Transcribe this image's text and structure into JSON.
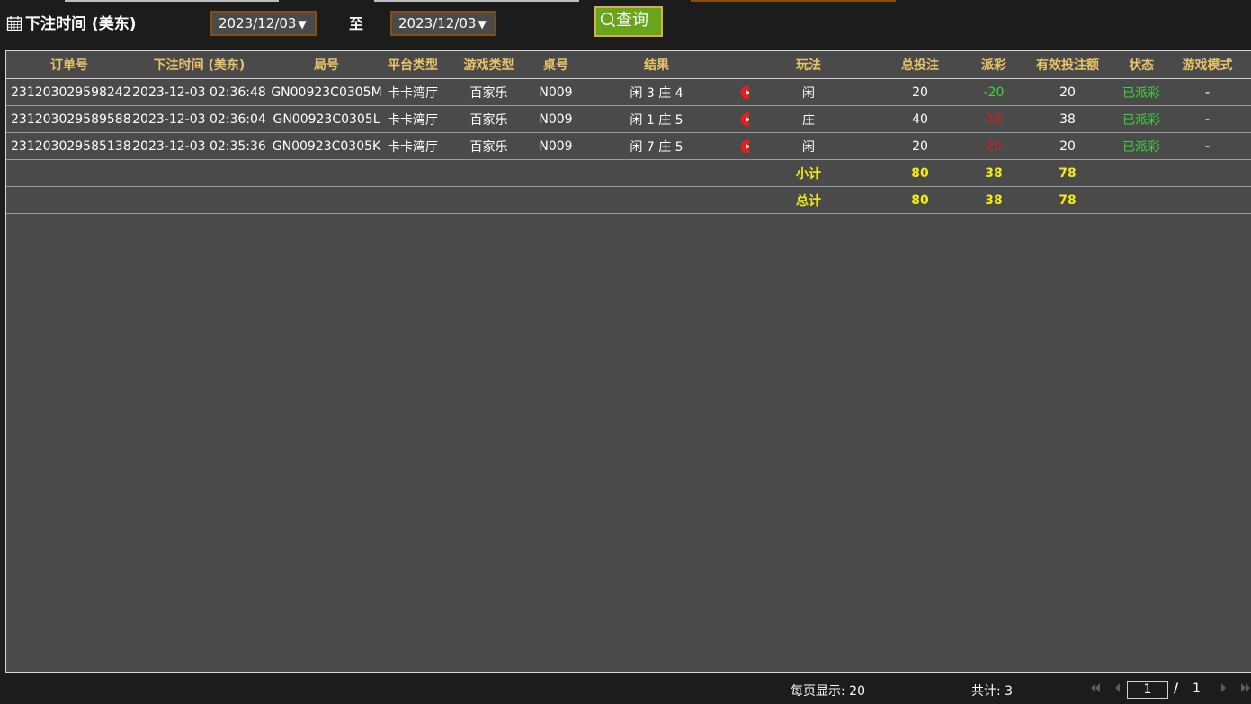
{
  "filter": {
    "label": "下注时间 (美东)",
    "date_from": "2023/12/03",
    "date_to": "2023/12/03",
    "dropdown_arrow": "▼",
    "to_label": "至",
    "query_label": "查询"
  },
  "table": {
    "headers": [
      "订单号",
      "下注时间 (美东)",
      "局号",
      "平台类型",
      "游戏类型",
      "桌号",
      "结果",
      "",
      "玩法",
      "总投注",
      "派彩",
      "有效投注额",
      "状态",
      "游戏模式"
    ],
    "rows": [
      {
        "order_no": "231203029598242",
        "bet_time": "2023-12-03 02:36:48",
        "round_no": "GN00923C0305M",
        "platform": "卡卡湾厅",
        "game_type": "百家乐",
        "table_no": "N009",
        "result": "闲 3 庄 4",
        "play": "闲",
        "total_bet": "20",
        "payout": "-20",
        "valid_bet": "20",
        "status": "已派彩",
        "mode": "-"
      },
      {
        "order_no": "231203029589588",
        "bet_time": "2023-12-03 02:36:04",
        "round_no": "GN00923C0305L",
        "platform": "卡卡湾厅",
        "game_type": "百家乐",
        "table_no": "N009",
        "result": "闲 1 庄 5",
        "play": "庄",
        "total_bet": "40",
        "payout": "38",
        "valid_bet": "38",
        "status": "已派彩",
        "mode": "-"
      },
      {
        "order_no": "231203029585138",
        "bet_time": "2023-12-03 02:35:36",
        "round_no": "GN00923C0305K",
        "platform": "卡卡湾厅",
        "game_type": "百家乐",
        "table_no": "N009",
        "result": "闲 7 庄 5",
        "play": "闲",
        "total_bet": "20",
        "payout": "20",
        "valid_bet": "20",
        "status": "已派彩",
        "mode": "-"
      }
    ],
    "subtotal": {
      "label": "小计",
      "total_bet": "80",
      "payout": "38",
      "valid_bet": "78"
    },
    "total": {
      "label": "总计",
      "total_bet": "80",
      "payout": "38",
      "valid_bet": "78"
    }
  },
  "footer": {
    "per_page": "每页显示: 20",
    "total_count": "共计: 3",
    "current_page": "1",
    "page_separator": "/",
    "total_pages": "1"
  },
  "colors": {
    "header_text": "#e8c46a",
    "summary_text": "#f2ec12",
    "positive": "#3fd13f",
    "negative": "#d81e1e",
    "query_button": "#6aa41a",
    "panel_bg": "#4a4a4a"
  },
  "icons": {
    "filter": "calendar-icon",
    "query": "search-icon",
    "replay": "play-icon",
    "pager": [
      "first-page-icon",
      "prev-page-icon",
      "next-page-icon",
      "last-page-icon"
    ]
  }
}
